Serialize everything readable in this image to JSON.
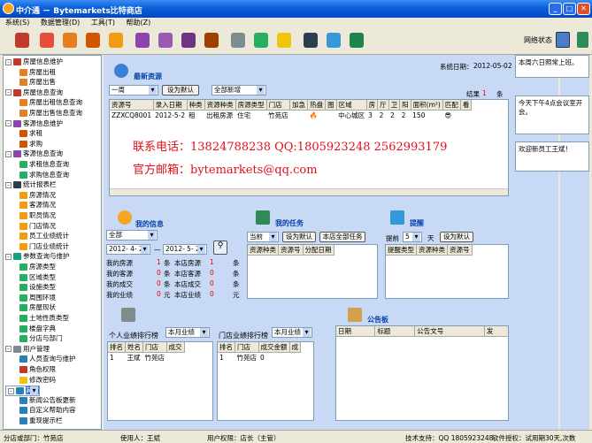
{
  "window": {
    "title": "中介通 － Bytemarkets比特商店"
  },
  "menu": [
    "系统(S)",
    "数据管理(D)",
    "工具(T)",
    "帮助(Z)"
  ],
  "toolbar": {
    "net_status": "网络状态"
  },
  "tree": [
    {
      "label": "房屋信息维护",
      "level": 0,
      "pm": "-",
      "color": "#c0392b"
    },
    {
      "label": "房屋出租",
      "level": 1,
      "color": "#e67e22"
    },
    {
      "label": "房屋出售",
      "level": 1,
      "color": "#e67e22"
    },
    {
      "label": "房屋信息查询",
      "level": 0,
      "pm": "-",
      "color": "#c0392b"
    },
    {
      "label": "房屋出租信息查询",
      "level": 1,
      "color": "#e67e22"
    },
    {
      "label": "房屋出售信息查询",
      "level": 1,
      "color": "#e67e22"
    },
    {
      "label": "客源信息维护",
      "level": 0,
      "pm": "-",
      "color": "#8e44ad"
    },
    {
      "label": "求租",
      "level": 1,
      "color": "#d35400"
    },
    {
      "label": "求购",
      "level": 1,
      "color": "#d35400"
    },
    {
      "label": "客源信息查询",
      "level": 0,
      "pm": "-",
      "color": "#8e44ad"
    },
    {
      "label": "求租信息查询",
      "level": 1,
      "color": "#27ae60"
    },
    {
      "label": "求购信息查询",
      "level": 1,
      "color": "#27ae60"
    },
    {
      "label": "统计报表栏",
      "level": 0,
      "pm": "-",
      "color": "#2c3e50"
    },
    {
      "label": "房源情况",
      "level": 1,
      "color": "#f39c12"
    },
    {
      "label": "客源情况",
      "level": 1,
      "color": "#f39c12"
    },
    {
      "label": "职员情况",
      "level": 1,
      "color": "#f39c12"
    },
    {
      "label": "门店情况",
      "level": 1,
      "color": "#f39c12"
    },
    {
      "label": "员工业绩统计",
      "level": 1,
      "color": "#f39c12"
    },
    {
      "label": "门店业绩统计",
      "level": 1,
      "color": "#f39c12"
    },
    {
      "label": "参数查询与维护",
      "level": 0,
      "pm": "-",
      "color": "#16a085"
    },
    {
      "label": "房源类型",
      "level": 1,
      "color": "#27ae60"
    },
    {
      "label": "区域类型",
      "level": 1,
      "color": "#27ae60"
    },
    {
      "label": "设施类型",
      "level": 1,
      "color": "#27ae60"
    },
    {
      "label": "周围环境",
      "level": 1,
      "color": "#27ae60"
    },
    {
      "label": "房屋现状",
      "level": 1,
      "color": "#27ae60"
    },
    {
      "label": "土地性质类型",
      "level": 1,
      "color": "#27ae60"
    },
    {
      "label": "楼盘字典",
      "level": 1,
      "color": "#27ae60"
    },
    {
      "label": "分店与部门",
      "level": 1,
      "color": "#27ae60"
    },
    {
      "label": "用户管理",
      "level": 0,
      "pm": "-",
      "color": "#7f8c8d"
    },
    {
      "label": "人员查询与维护",
      "level": 1,
      "color": "#2980b9"
    },
    {
      "label": "角色权限",
      "level": 1,
      "color": "#c0392b"
    },
    {
      "label": "修改密码",
      "level": 1,
      "color": "#f1c40f"
    },
    {
      "label": "其它",
      "level": 0,
      "pm": "-",
      "color": "#2980b9",
      "selected": true
    },
    {
      "label": "新闻公告板更新",
      "level": 1,
      "color": "#2980b9"
    },
    {
      "label": "自定义帮助内容",
      "level": 1,
      "color": "#2980b9"
    },
    {
      "label": "重现提示栏",
      "level": 1,
      "color": "#2980b9"
    }
  ],
  "resources": {
    "title": "最新资源",
    "system_date_label": "系统日期：",
    "system_date": "2012-05-02",
    "period": "一周",
    "set_default": "设为默认",
    "filter": "全部新增",
    "result_label": "结果",
    "result_count": "1",
    "result_unit": "条",
    "columns": [
      "资源号",
      "录入日期",
      "种类",
      "资源种类",
      "房源类型",
      "门店",
      "加急",
      "热盘",
      "图",
      "区域",
      "房",
      "厅",
      "卫",
      "阳",
      "面积(m²)",
      "匹配",
      "看"
    ],
    "rows": [
      [
        "ZZXCQ8001",
        "2012-5-2",
        "租",
        "出租房源",
        "住宅",
        "竹苑店",
        "",
        "🔥",
        "",
        "中心城区",
        "3",
        "2",
        "2",
        "2",
        "150",
        "😎",
        ""
      ]
    ],
    "phone": "联系电话：13824788238    QQ:1805923248  2562993179",
    "email": "官方邮箱：bytemarkets@qq.com"
  },
  "myinfo": {
    "title": "我的信息",
    "filter": "全部",
    "date_from": "2012- 4- 2",
    "date_sep": "—",
    "date_to": "2012- 5- 2",
    "lines": [
      {
        "label": "我的房源",
        "value": "1",
        "unit": "条",
        "store_label": "本店房源",
        "store_value": "1",
        "store_unit": "条"
      },
      {
        "label": "我的客源",
        "value": "0",
        "unit": "条",
        "store_label": "本店客源",
        "store_value": "0",
        "store_unit": "条"
      },
      {
        "label": "我的成交",
        "value": "0",
        "unit": "条",
        "store_label": "本店成交",
        "store_value": "0",
        "store_unit": "条"
      },
      {
        "label": "我的业绩",
        "value": "0",
        "unit": "元",
        "store_label": "本店业绩",
        "store_value": "0",
        "store_unit": "元"
      }
    ]
  },
  "mytasks": {
    "title": "我的任务",
    "period": "当前",
    "set_default": "设为默认",
    "all_tasks": "本店全部任务",
    "columns": [
      "资源种类",
      "资源号",
      "分配日期"
    ]
  },
  "reminder": {
    "title": "提醒",
    "advance_label": "提前",
    "days": "5",
    "days_unit": "天",
    "set_default": "设为默认",
    "columns": [
      "提醒类型",
      "资源种类",
      "资源号"
    ]
  },
  "rank": {
    "personal_label": "个人业绩排行榜",
    "personal_period": "本月业绩",
    "personal_columns": [
      "排名",
      "姓名",
      "门店",
      "成交"
    ],
    "personal_rows": [
      [
        "1",
        "王斌",
        "竹苑店",
        ""
      ]
    ],
    "store_label": "门店业绩排行榜",
    "store_period": "本月业绩",
    "store_columns": [
      "排名",
      "门店",
      "成交金额",
      "成"
    ],
    "store_rows": [
      [
        "1",
        "竹苑店",
        "0",
        ""
      ]
    ]
  },
  "bulletin": {
    "title": "公告板",
    "columns": [
      "日期",
      "标题",
      "公告文号",
      "发"
    ]
  },
  "notes": [
    "本周六日照常上班。",
    "今天下午4点会议室开会。",
    "欢迎新员工王斌！"
  ],
  "status": {
    "store": "分店或部门：竹苑店",
    "user": "使用人：王斌",
    "perm": "用户权限：店长（主管）",
    "support": "技术支持：QQ 1805923248",
    "license": "软件授权：试用期30天,次数"
  }
}
